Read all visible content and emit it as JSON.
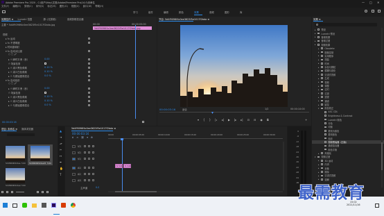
{
  "window": {
    "title": "Adobe Premiere Pro 2020 - C:\\用户\\lhby\\文档\\Adobe\\Premiere Pro\\14.0\\未命名",
    "controls": [
      "—",
      "□",
      "✕"
    ]
  },
  "menu": [
    "文件(F)",
    "编辑(E)",
    "剪辑(C)",
    "序列(S)",
    "标记(M)",
    "图形(G)",
    "视图(V)",
    "窗口(W)",
    "帮助(H)"
  ],
  "workspaces": {
    "items": [
      "学习",
      "组件",
      "编辑",
      "颜色",
      "效果",
      "音频",
      "图形",
      "库"
    ],
    "active_index": 4
  },
  "effect_controls": {
    "tabs": [
      "效果控件 ≡",
      "Lumetri 范围",
      "源: (无剪辑)",
      "音频剪辑混合器"
    ],
    "master": "主要 * 5d4f9096f4c0ee3623f5e1017f2bda.jpg",
    "clip_chip": "5d4f9096f4c0ee3623f5e1017f2bda.jpg",
    "time_start": "00:00",
    "time_end": "00:00:05:00",
    "rows": [
      {
        "text": "视频",
        "indent": 0,
        "value": "",
        "kind": "header"
      },
      {
        "text": "▸ fx 运动",
        "indent": 1,
        "value": "",
        "kind": "fx"
      },
      {
        "text": "▸ fx 不透明度",
        "indent": 1,
        "value": "",
        "kind": "fx"
      },
      {
        "text": "▸ 时间重映射",
        "indent": 1,
        "value": "",
        "kind": "fx"
      },
      {
        "text": "▾ fx 自动对比度",
        "indent": 1,
        "value": "",
        "kind": "fx"
      },
      {
        "text": "○ □ 🖉",
        "indent": 2,
        "value": "",
        "kind": "masks"
      },
      {
        "text": "▸ ⏱ 瞬时平滑（秒）",
        "indent": 2,
        "value": "0.00",
        "kind": "param"
      },
      {
        "text": "⏱ 场景检测",
        "indent": 2,
        "value": "",
        "kind": "check"
      },
      {
        "text": "▸ ⏱ 减少黑色像素",
        "indent": 2,
        "value": "0.10 %",
        "kind": "param"
      },
      {
        "text": "▸ ⏱ 减少白色像素",
        "indent": 2,
        "value": "0.10 %",
        "kind": "param"
      },
      {
        "text": "▸ ⏱ 与原始图像混合",
        "indent": 2,
        "value": "0.0 %",
        "kind": "param"
      },
      {
        "text": "▾ fx 自动色阶",
        "indent": 1,
        "value": "",
        "kind": "fx"
      },
      {
        "text": "○ □ 🖉",
        "indent": 2,
        "value": "",
        "kind": "masks"
      },
      {
        "text": "▸ ⏱ 瞬时平滑（秒）",
        "indent": 2,
        "value": "0.00",
        "kind": "param"
      },
      {
        "text": "⏱ 场景检测",
        "indent": 2,
        "value": "",
        "kind": "check"
      },
      {
        "text": "▸ ⏱ 减少黑色像素",
        "indent": 2,
        "value": "0.10 %",
        "kind": "param"
      },
      {
        "text": "▸ ⏱ 减少白色像素",
        "indent": 2,
        "value": "0.10 %",
        "kind": "param"
      },
      {
        "text": "▸ ⏱ 与原始图像混合",
        "indent": 2,
        "value": "0.0 %",
        "kind": "param"
      }
    ],
    "bottom_timecode": "00:00:03:16"
  },
  "program": {
    "tab": "节目: 5d4f9096f4c0ee3623f5e1017f2bda ≡",
    "timecode": "00:00:03:16",
    "fit": "适合",
    "scale": "1/2",
    "duration": "00:00:10:00"
  },
  "effects": {
    "tab": "效果 ≡",
    "items": [
      {
        "label": "预设",
        "level": 0,
        "type": "folder"
      },
      {
        "label": "Lumetri 预设",
        "level": 0,
        "type": "folder"
      },
      {
        "label": "音频效果",
        "level": 0,
        "type": "folder"
      },
      {
        "label": "音频过渡",
        "level": 0,
        "type": "folder"
      },
      {
        "label": "视频效果",
        "level": 0,
        "type": "folder"
      },
      {
        "label": "Obsolete",
        "level": 1,
        "type": "folder"
      },
      {
        "label": "图像控制",
        "level": 1,
        "type": "folder"
      },
      {
        "label": "实用程序",
        "level": 1,
        "type": "folder"
      },
      {
        "label": "扭曲",
        "level": 1,
        "type": "folder"
      },
      {
        "label": "时间",
        "level": 1,
        "type": "folder"
      },
      {
        "label": "杂色与颗粒",
        "level": 1,
        "type": "folder"
      },
      {
        "label": "模糊与锐化",
        "level": 1,
        "type": "folder"
      },
      {
        "label": "沉浸式视频",
        "level": 1,
        "type": "folder"
      },
      {
        "label": "生成",
        "level": 1,
        "type": "folder"
      },
      {
        "label": "视频",
        "level": 1,
        "type": "folder"
      },
      {
        "label": "调整",
        "level": 1,
        "type": "folder"
      },
      {
        "label": "过时",
        "level": 1,
        "type": "folder"
      },
      {
        "label": "过渡",
        "level": 1,
        "type": "folder"
      },
      {
        "label": "透视",
        "level": 1,
        "type": "folder"
      },
      {
        "label": "通道",
        "level": 1,
        "type": "folder"
      },
      {
        "label": "键控",
        "level": 1,
        "type": "folder"
      },
      {
        "label": "颜色校正",
        "level": 1,
        "type": "folder-open"
      },
      {
        "label": "ASC CDL",
        "level": 2,
        "type": "effect"
      },
      {
        "label": "Brightness & Contrast",
        "level": 2,
        "type": "effect"
      },
      {
        "label": "Lumetri 颜色",
        "level": 2,
        "type": "effect"
      },
      {
        "label": "分色",
        "level": 2,
        "type": "effect"
      },
      {
        "label": "均衡",
        "level": 2,
        "type": "effect"
      },
      {
        "label": "更改为颜色",
        "level": 2,
        "type": "effect"
      },
      {
        "label": "更改颜色",
        "level": 2,
        "type": "effect"
      },
      {
        "label": "色彩",
        "level": 2,
        "type": "effect"
      },
      {
        "label": "视频限幅器（旧版）",
        "level": 2,
        "type": "effect",
        "selected": true
      },
      {
        "label": "通道混合器",
        "level": 2,
        "type": "effect"
      },
      {
        "label": "颜色平衡",
        "level": 2,
        "type": "effect"
      },
      {
        "label": "风格化",
        "level": 1,
        "type": "folder"
      },
      {
        "label": "视频过渡",
        "level": 0,
        "type": "folder-open"
      },
      {
        "label": "3D 运动",
        "level": 1,
        "type": "folder"
      },
      {
        "label": "内滑",
        "level": 1,
        "type": "folder"
      },
      {
        "label": "划像",
        "level": 1,
        "type": "folder"
      },
      {
        "label": "擦除",
        "level": 1,
        "type": "folder"
      },
      {
        "label": "沉浸式视频",
        "level": 1,
        "type": "folder"
      },
      {
        "label": "溶解",
        "level": 1,
        "type": "folder"
      }
    ]
  },
  "project": {
    "tabs": [
      "项目: 未命名 ≡",
      "媒体浏览器"
    ],
    "search_placeholder": "",
    "items": [
      {
        "name": "5d4f9096f4c0ee...",
        "dur": "5:00"
      },
      {
        "name": "5d4f9096f4c0ee3623...",
        "dur": "5:00"
      },
      {
        "name": "5d4f9096f4c0ee3623...",
        "dur": "5:00"
      }
    ]
  },
  "timeline": {
    "tab": "5d4f9096f4c0ee3623f5e1017f2bda ≡",
    "timecode": "00:00:03:16",
    "ruler": [
      "00:00",
      "00:00:05:00",
      "00:00:10:00",
      "00:00:15:00",
      "00:00:20:00",
      "00:00:25:00",
      "00:00:30:00"
    ],
    "tracks": [
      "V3",
      "V2",
      "V1",
      "A1",
      "A2",
      "A3"
    ],
    "master": "主声道",
    "master_value": "0.0",
    "clips": [
      {
        "label": "fx 5d4",
        "track": "V1"
      },
      {
        "label": "fx 5d4",
        "track": "V1"
      }
    ],
    "meter_labels": [
      "0",
      "-6",
      "-12",
      "-18",
      "-24",
      "-30",
      "-36",
      "-42",
      "-48",
      "-54",
      "dB"
    ]
  },
  "watermark": "最需教育",
  "taskbar": {
    "clock": "15:02",
    "date": "2021/11/16"
  },
  "colors": {
    "accent_blue": "#2d8ceb",
    "clip_pink": "#e18fd9",
    "playhead": "#4a8df0"
  }
}
